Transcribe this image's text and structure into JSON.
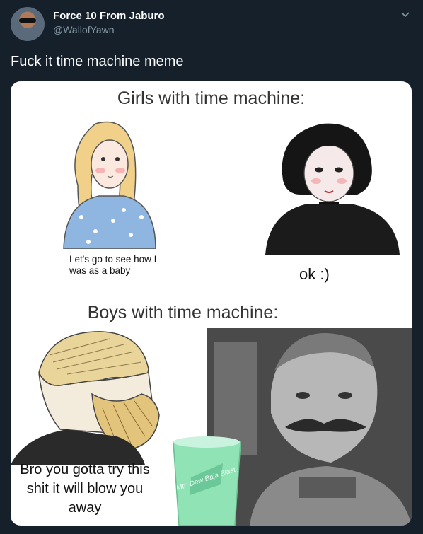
{
  "tweet": {
    "author_name": "Force 10 From Jaburo",
    "author_handle": "@WallofYawn",
    "text": "Fuck it time machine meme"
  },
  "meme": {
    "title_girls": "Girls with time machine:",
    "caption_girl_left": "Let's go to see how I was as a baby",
    "caption_girl_right": "ok :)",
    "title_boys": "Boys with time machine:",
    "caption_boy": "Bro you gotta try this shit it will blow you away",
    "cup_label": "Mtn Dew Baja Blast"
  },
  "colors": {
    "background": "#15202b",
    "secondary_text": "#8899a6"
  },
  "icons": {
    "menu": "chevron-down-icon"
  }
}
